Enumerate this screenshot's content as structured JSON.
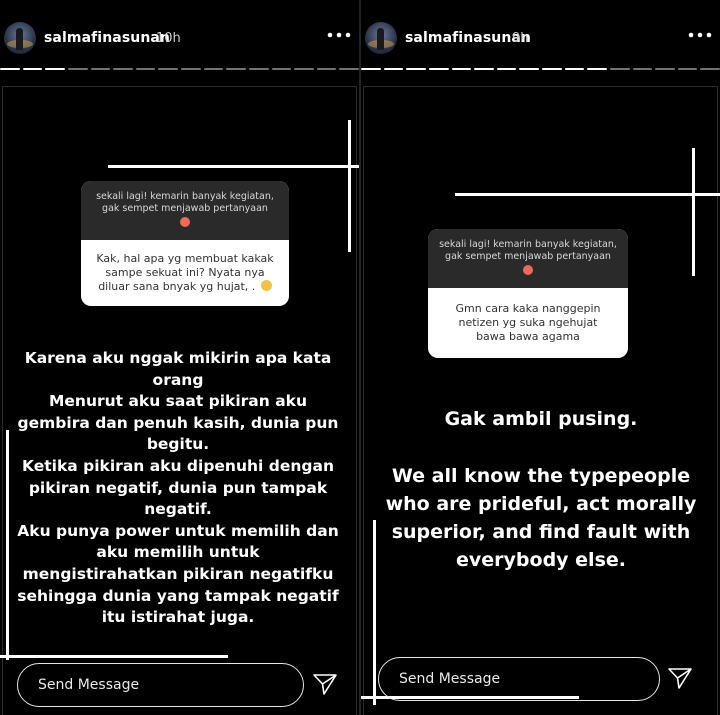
{
  "stories": [
    {
      "username": "salmafinasunan",
      "time": "10h",
      "question_header": "sekali lagi! kemarin banyak kegiatan, gak sempet menjawab pertanyaan",
      "question": "Kak, hal apa yg membuat kakak sampe sekuat ini? Nyata nya diluar sana bnyak yg hujat, .",
      "answer_lines": [
        "Karena aku nggak mikirin apa kata",
        "orang",
        "Menurut aku saat pikiran aku",
        "gembira dan penuh kasih, dunia pun",
        "begitu.",
        "Ketika pikiran aku dipenuhi dengan",
        "pikiran negatif, dunia pun tampak",
        "negatif.",
        "Aku punya power untuk memilih dan",
        "aku memilih untuk",
        "mengistirahatkan pikiran negatifku",
        "sehingga dunia yang tampak negatif",
        "itu istirahat juga."
      ],
      "send_placeholder": "Send Message"
    },
    {
      "username": "salmafinasunan",
      "time": "9h",
      "question_header": "sekali lagi! kemarin banyak kegiatan, gak sempet menjawab pertanyaan",
      "question": "Gmn cara kaka nanggepin netizen yg suka ngehujat bawa bawa agama",
      "answer_title": "Gak ambil pusing.",
      "answer_lines": [
        "We all know the typepeople",
        "who are prideful, act morally",
        "superior, and find fault with",
        "everybody else."
      ],
      "send_placeholder": "Send Message"
    }
  ],
  "icons": {
    "more": "more-horizontal-icon",
    "send": "paper-plane-icon",
    "emoji": "emoji-icon"
  },
  "colors": {
    "background": "#000000",
    "question_header_bg": "#2a2a2a",
    "question_body_bg": "#ffffff",
    "text": "#ffffff"
  }
}
